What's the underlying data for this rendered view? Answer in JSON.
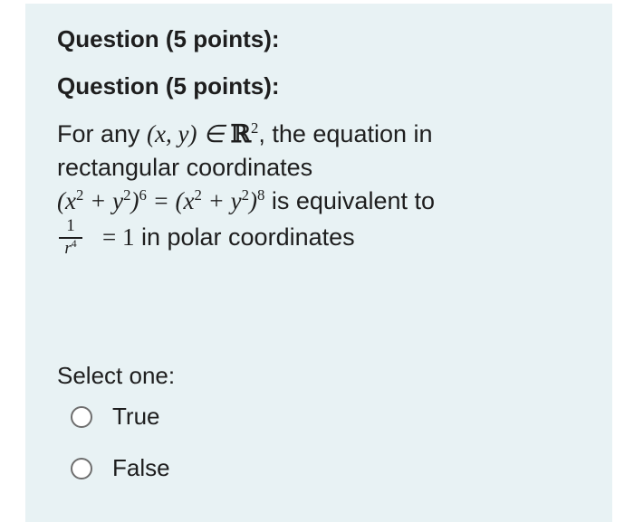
{
  "question": {
    "title_1": "Question (5 points):",
    "title_2": "Question (5 points):",
    "text": {
      "l1_a": "For any ",
      "l1_math": "(x, y) ∈ ",
      "l1_R": "ℝ",
      "l1_exp": "2",
      "l1_b": ", the equation in",
      "l2": "rectangular coordinates",
      "l3_math_a": "(x",
      "l3_sup1": "2",
      "l3_math_b": " + y",
      "l3_sup2": "2",
      "l3_math_c": ")",
      "l3_sup3": "6",
      "l3_math_d": " = (x",
      "l3_sup4": "2",
      "l3_math_e": " + y",
      "l3_sup5": "2",
      "l3_math_f": ")",
      "l3_sup6": "8",
      "l3_b": " is equivalent to",
      "frac_num": "1",
      "frac_den": "r",
      "frac_den_exp": "4",
      "l4_math": "= 1",
      "l4_b": " in polar coordinates"
    }
  },
  "select_label": "Select one:",
  "options": [
    {
      "label": "True",
      "selected": false
    },
    {
      "label": "False",
      "selected": false
    }
  ],
  "colors": {
    "card_background": "#e8f2f4",
    "text": "#1e1e1e",
    "radio_border": "#6e6e6e"
  }
}
